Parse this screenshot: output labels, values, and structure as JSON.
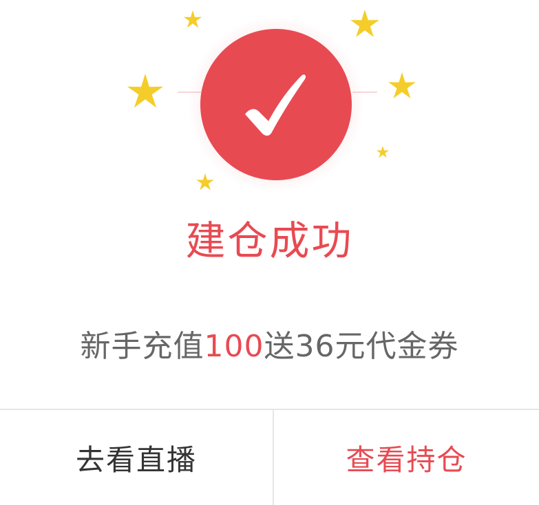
{
  "dialog": {
    "icon": "check-circle-icon",
    "decorations": "star-icon",
    "title": "建仓成功",
    "promo": {
      "before": "新手充值",
      "highlight": "100",
      "after": "送36元代金券"
    },
    "buttons": {
      "left_label": "去看直播",
      "right_label": "查看持仓"
    }
  },
  "colors": {
    "accent": "#e84a52",
    "star": "#f5cd2a",
    "text_primary": "#333333",
    "text_secondary": "#666666",
    "divider": "#e6e6e6",
    "background": "#ffffff"
  }
}
